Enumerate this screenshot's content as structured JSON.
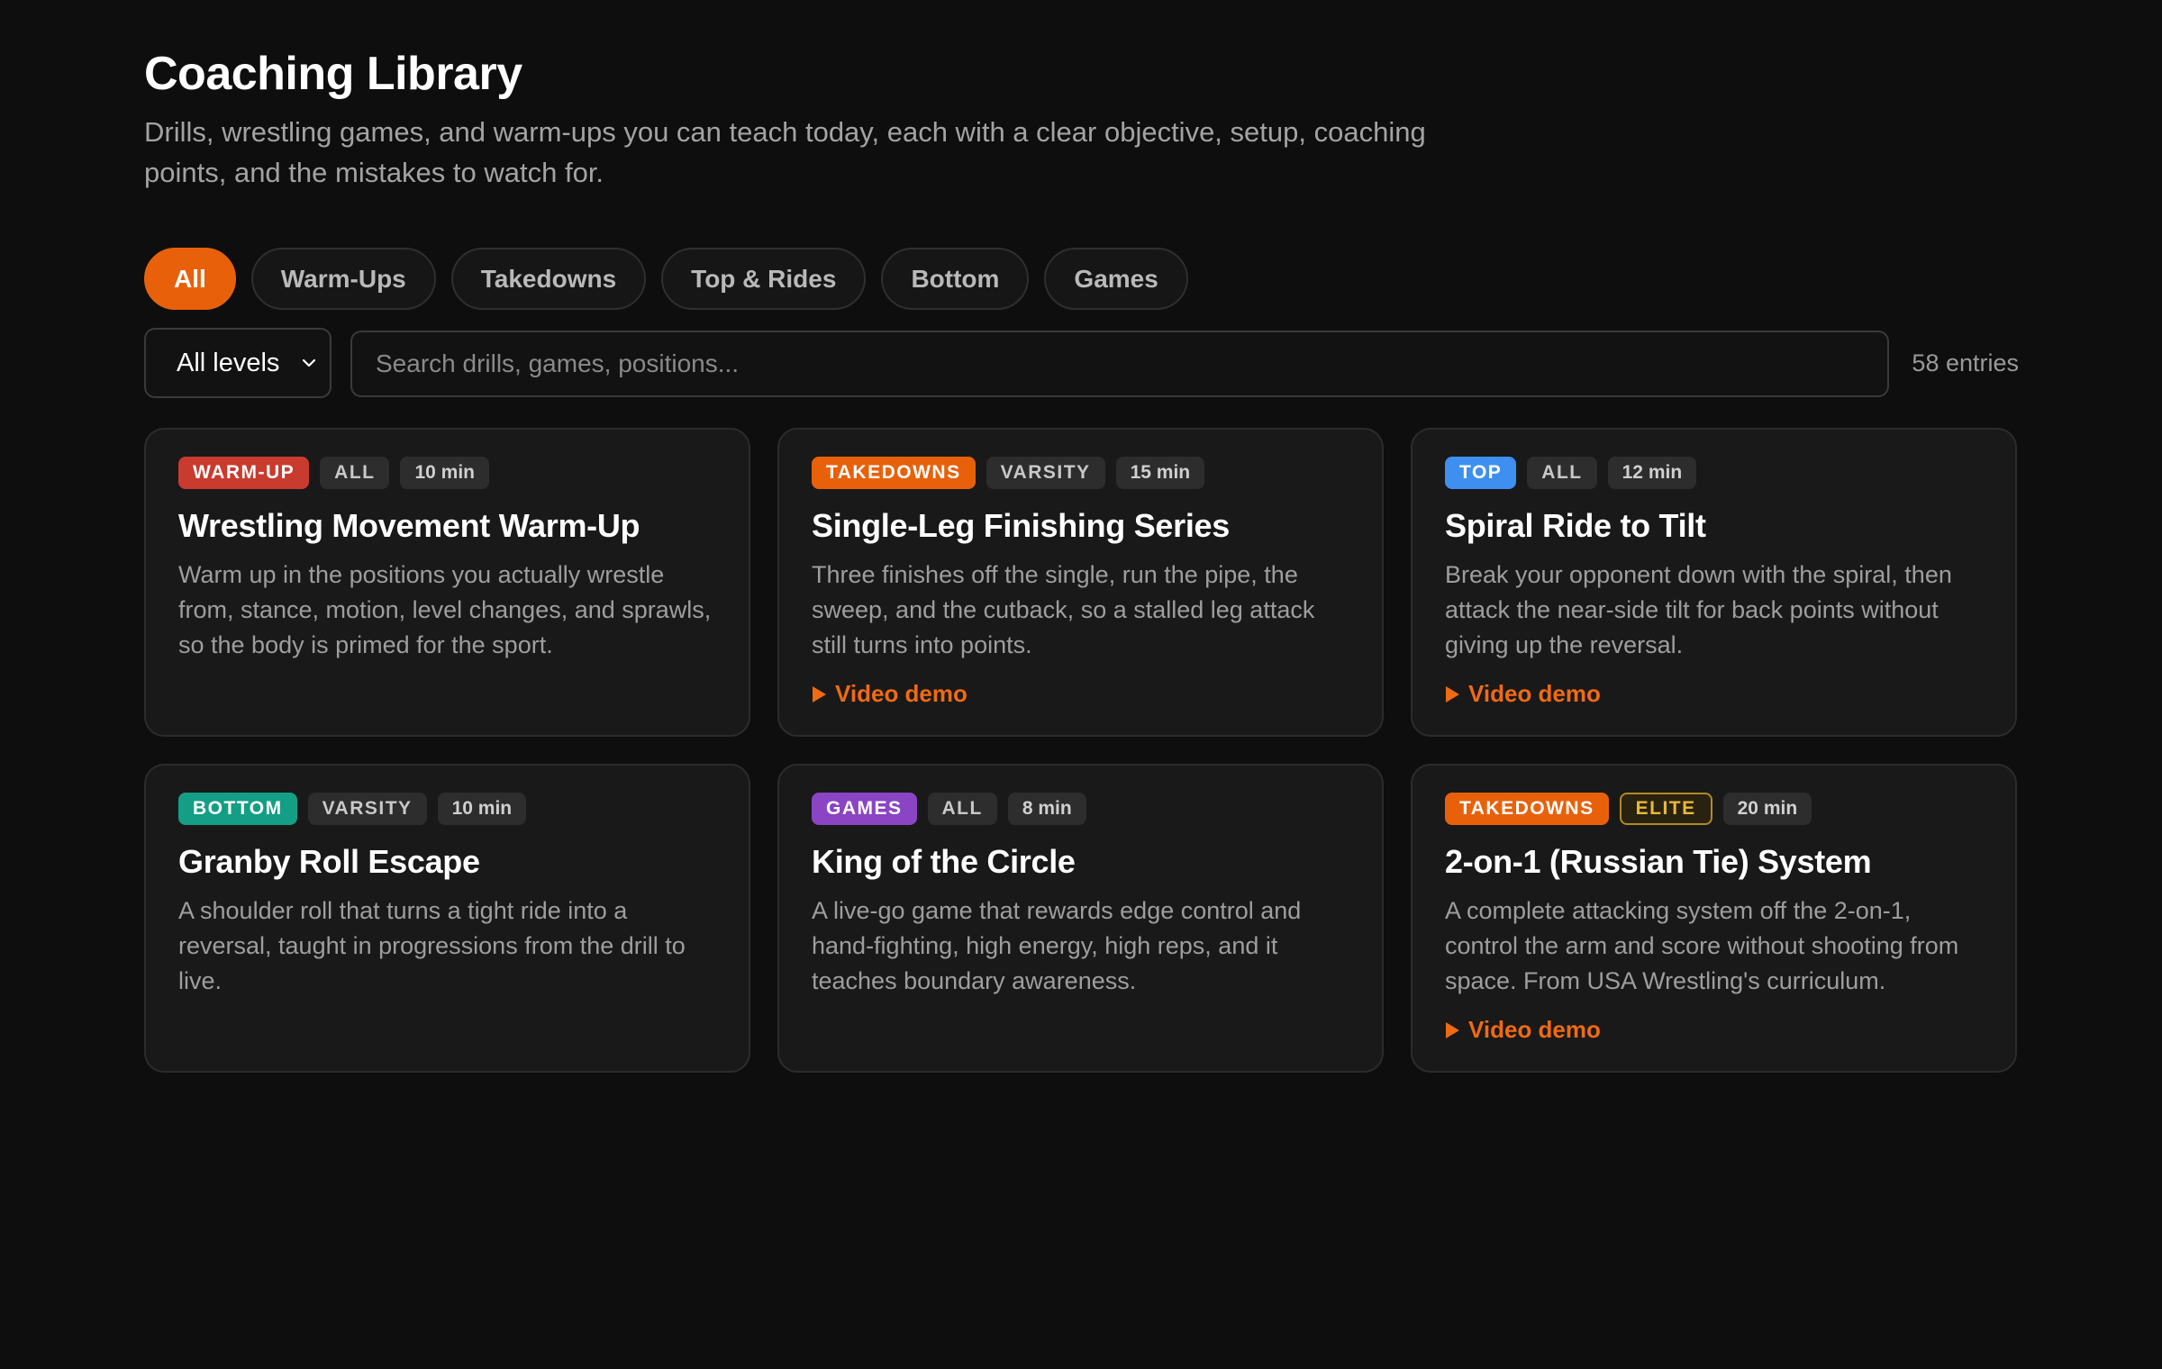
{
  "header": {
    "title": "Coaching Library",
    "subtitle": "Drills, wrestling games, and warm-ups you can teach today, each with a clear objective, setup, coaching points, and the mistakes to watch for."
  },
  "tabs": [
    {
      "label": "All",
      "active": true
    },
    {
      "label": "Warm-Ups",
      "active": false
    },
    {
      "label": "Takedowns",
      "active": false
    },
    {
      "label": "Top & Rides",
      "active": false
    },
    {
      "label": "Bottom",
      "active": false
    },
    {
      "label": "Games",
      "active": false
    }
  ],
  "filters": {
    "level_selected": "All levels",
    "search_placeholder": "Search drills, games, positions...",
    "search_value": "",
    "entries": "58 entries"
  },
  "colors": {
    "accent": "#e8610a",
    "warmup": "#c93b2e",
    "takedowns": "#e8610a",
    "top": "#3f8ff0",
    "bottom": "#139e85",
    "games": "#8a44c4",
    "elite": "#e8b93a"
  },
  "cards": [
    {
      "category": "WARM-UP",
      "category_color": "#c93b2e",
      "level": "ALL",
      "time": "10 min",
      "title": "Wrestling Movement Warm-Up",
      "description": "Warm up in the positions you actually wrestle from, stance, motion, level changes, and sprawls, so the body is primed for the sport.",
      "video": ""
    },
    {
      "category": "TAKEDOWNS",
      "category_color": "#e8610a",
      "level": "VARSITY",
      "time": "15 min",
      "title": "Single-Leg Finishing Series",
      "description": "Three finishes off the single, run the pipe, the sweep, and the cutback, so a stalled leg attack still turns into points.",
      "video": "Video demo"
    },
    {
      "category": "TOP",
      "category_color": "#3f8ff0",
      "level": "ALL",
      "time": "12 min",
      "title": "Spiral Ride to Tilt",
      "description": "Break your opponent down with the spiral, then attack the near-side tilt for back points without giving up the reversal.",
      "video": "Video demo"
    },
    {
      "category": "BOTTOM",
      "category_color": "#139e85",
      "level": "VARSITY",
      "time": "10 min",
      "title": "Granby Roll Escape",
      "description": "A shoulder roll that turns a tight ride into a reversal, taught in progressions from the drill to live.",
      "video": ""
    },
    {
      "category": "GAMES",
      "category_color": "#8a44c4",
      "level": "ALL",
      "time": "8 min",
      "title": "King of the Circle",
      "description": "A live-go game that rewards edge control and hand-fighting, high energy, high reps, and it teaches boundary awareness.",
      "video": ""
    },
    {
      "category": "TAKEDOWNS",
      "category_color": "#e8610a",
      "level": "ELITE",
      "level_style": "elite",
      "time": "20 min",
      "title": "2-on-1 (Russian Tie) System",
      "description": "A complete attacking system off the 2-on-1, control the arm and score without shooting from space. From USA Wrestling's curriculum.",
      "video": "Video demo"
    }
  ]
}
